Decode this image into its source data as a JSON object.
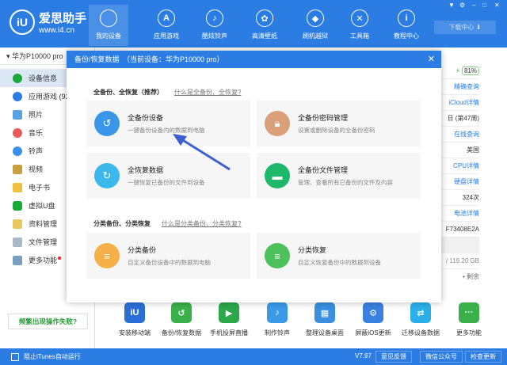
{
  "header": {
    "logo_mark": "iU",
    "app_name": "爱思助手",
    "url": "www.i4.cn",
    "nav": [
      {
        "label": "我的设备",
        "icon": "apple-icon"
      },
      {
        "label": "应用游戏",
        "icon": "app-store-icon"
      },
      {
        "label": "酷炫铃声",
        "icon": "bell-icon"
      },
      {
        "label": "高清壁纸",
        "icon": "wallpaper-icon"
      },
      {
        "label": "刷机越狱",
        "icon": "dropbox-icon"
      },
      {
        "label": "工具箱",
        "icon": "tools-icon"
      },
      {
        "label": "教程中心",
        "icon": "info-icon"
      }
    ],
    "download": "下载中心 ⬇"
  },
  "sidebar": {
    "device": "华为P10000 pro",
    "items": [
      {
        "label": "设备信息",
        "color": "#1aaa3a"
      },
      {
        "label": "应用游戏 (92)",
        "color": "#2b7de3"
      },
      {
        "label": "照片",
        "color": "#5aa0e0"
      },
      {
        "label": "音乐",
        "color": "#e85a5a"
      },
      {
        "label": "铃声",
        "color": "#3a8fe8"
      },
      {
        "label": "视频",
        "color": "#c9a040"
      },
      {
        "label": "电子书",
        "color": "#f0c040"
      },
      {
        "label": "虚拟U盘",
        "color": "#1aaa3a"
      },
      {
        "label": "资料管理",
        "color": "#e8c860"
      },
      {
        "label": "文件管理",
        "color": "#aab8c8"
      },
      {
        "label": "更多功能",
        "color": "#7aa0c0"
      }
    ],
    "feedback": "频繁出现操作失败?"
  },
  "modal": {
    "title": "备份/恢复数据　（当前设备：华为P10000 pro）",
    "section1": {
      "label": "全备份、全恢复（推荐）",
      "link": "什么是全备份、全恢复?"
    },
    "section2": {
      "label": "分类备份、分类恢复",
      "link": "什么是分类备份、分类恢复?"
    },
    "cards": [
      {
        "title": "全备份设备",
        "desc": "一键备份设备内的数据到电脑",
        "color": "#3b95e8"
      },
      {
        "title": "全备份密码管理",
        "desc": "设置或删除设备的全备份密码",
        "color": "#d9a07a"
      },
      {
        "title": "全恢复数据",
        "desc": "一键恢复已备份的文件到设备",
        "color": "#3bb8ec"
      },
      {
        "title": "全备份文件管理",
        "desc": "管理、查看所有已备份的文件及内容",
        "color": "#1db86a"
      },
      {
        "title": "分类备份",
        "desc": "自定义备份设备中的数据到电脑",
        "color": "#f5b04a"
      },
      {
        "title": "分类恢复",
        "desc": "自定义恢复备份中的数据到设备",
        "color": "#4cc05a"
      }
    ]
  },
  "right": {
    "rows": [
      "81%",
      "精确查询",
      "iCloud详情",
      "日 (第47周)",
      "在线查询",
      "美国",
      "CPU详情",
      "硬盘详情",
      "324次",
      "电池详情",
      "F73408E2A",
      "",
      "/ 119.20 GB",
      "剩余"
    ]
  },
  "toolbar": [
    {
      "label": "安装移动端",
      "color": "#2b6fd6"
    },
    {
      "label": "备份/恢复数据",
      "color": "#3bb04a"
    },
    {
      "label": "手机投屏直播",
      "color": "#2aa84a"
    },
    {
      "label": "制作铃声",
      "color": "#3a9ae8"
    },
    {
      "label": "整理设备桌面",
      "color": "#3a8fe0"
    },
    {
      "label": "屏蔽iOS更新",
      "color": "#3a80e0"
    },
    {
      "label": "迁移设备数据",
      "color": "#2ab0e8"
    },
    {
      "label": "更多功能",
      "color": "#3ab04a"
    }
  ],
  "footer": {
    "itunes": "阻止iTunes自动运行",
    "version": "V7.97",
    "feedback": "意见反馈",
    "wechat": "微信公众号",
    "update": "检查更新"
  }
}
